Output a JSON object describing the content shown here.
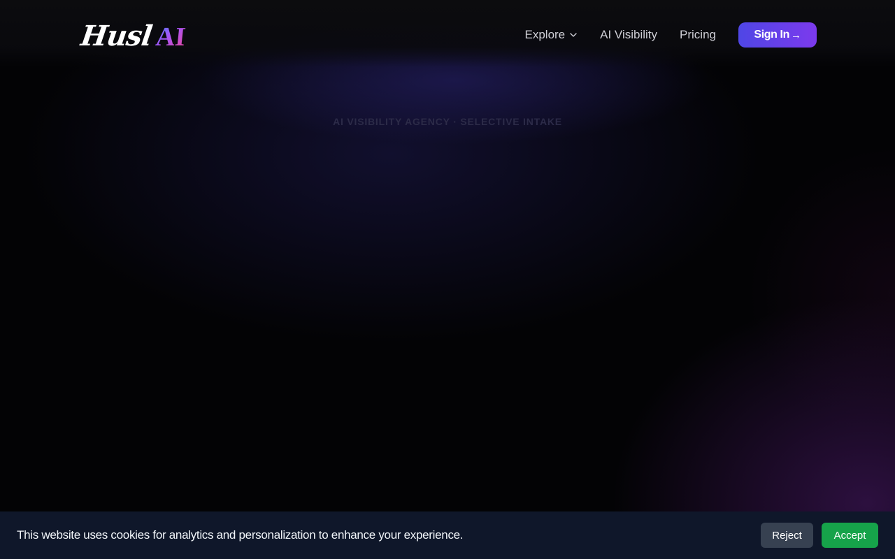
{
  "header": {
    "logo_text": "Husl",
    "logo_accent": "AI",
    "nav": [
      {
        "label": "Explore",
        "has_dropdown": true
      },
      {
        "label": "AI Visibility"
      },
      {
        "label": "Pricing"
      }
    ],
    "signin_label": "Sign In",
    "signin_arrow": "→"
  },
  "hero": {
    "eyebrow": "AI VISIBILITY AGENCY · SELECTIVE INTAKE"
  },
  "cookie_banner": {
    "message": "This website uses cookies for analytics and personalization to enhance your experience.",
    "reject_label": "Reject",
    "accept_label": "Accept"
  },
  "colors": {
    "accent_start": "#4f46e5",
    "accent_end": "#7c3aed",
    "accept_green": "#16a34a",
    "reject_gray": "#374151",
    "cookie_bg": "#0f172a"
  },
  "icons": {
    "dropdown": "chevron-down-icon",
    "signin_arrow": "arrow-right-icon"
  }
}
